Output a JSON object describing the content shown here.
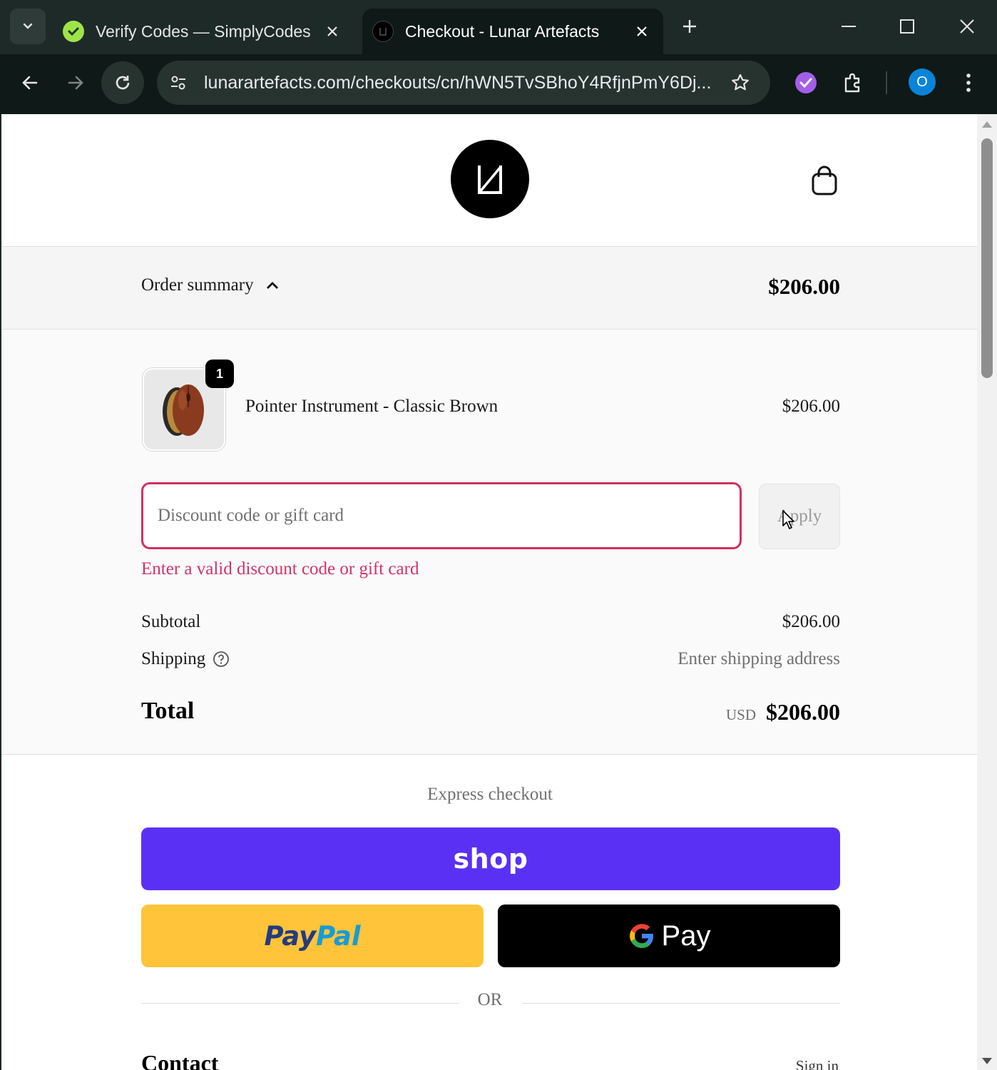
{
  "browser": {
    "tabs": [
      {
        "title": "Verify Codes — SimplyCodes",
        "active": false
      },
      {
        "title": "Checkout - Lunar Artefacts",
        "active": true
      }
    ],
    "url": "lunarartefacts.com/checkouts/cn/hWN5TvSBhoY4RfjnPmY6Dj...",
    "profile_initial": "O",
    "colors": {
      "tabstrip": "#1e2a28",
      "toolbar": "#0f1918",
      "omnibox": "#27332f"
    }
  },
  "store": {
    "logo": "lunar-artefacts-logo"
  },
  "summary": {
    "toggle_label": "Order summary",
    "total": "$206.00"
  },
  "order": {
    "items": [
      {
        "name": "Pointer Instrument - Classic Brown",
        "price": "$206.00",
        "quantity": "1"
      }
    ],
    "discount": {
      "placeholder": "Discount code or gift card",
      "value": "",
      "apply_label": "Apply",
      "error": "Enter a valid discount code or gift card"
    },
    "subtotal_label": "Subtotal",
    "subtotal_value": "$206.00",
    "shipping_label": "Shipping",
    "shipping_value": "Enter shipping address",
    "total_label": "Total",
    "total_currency": "USD",
    "total_value": "$206.00"
  },
  "express": {
    "label": "Express checkout",
    "shop_label": "shop",
    "paypal_part1": "Pay",
    "paypal_part2": "Pal",
    "gpay_label": "Pay",
    "or_label": "OR"
  },
  "contact": {
    "heading": "Contact",
    "signin_label": "Sign in"
  },
  "colors": {
    "error": "#d3326a",
    "shop": "#5a31f4",
    "paypal": "#ffc439",
    "gpay": "#000000"
  }
}
